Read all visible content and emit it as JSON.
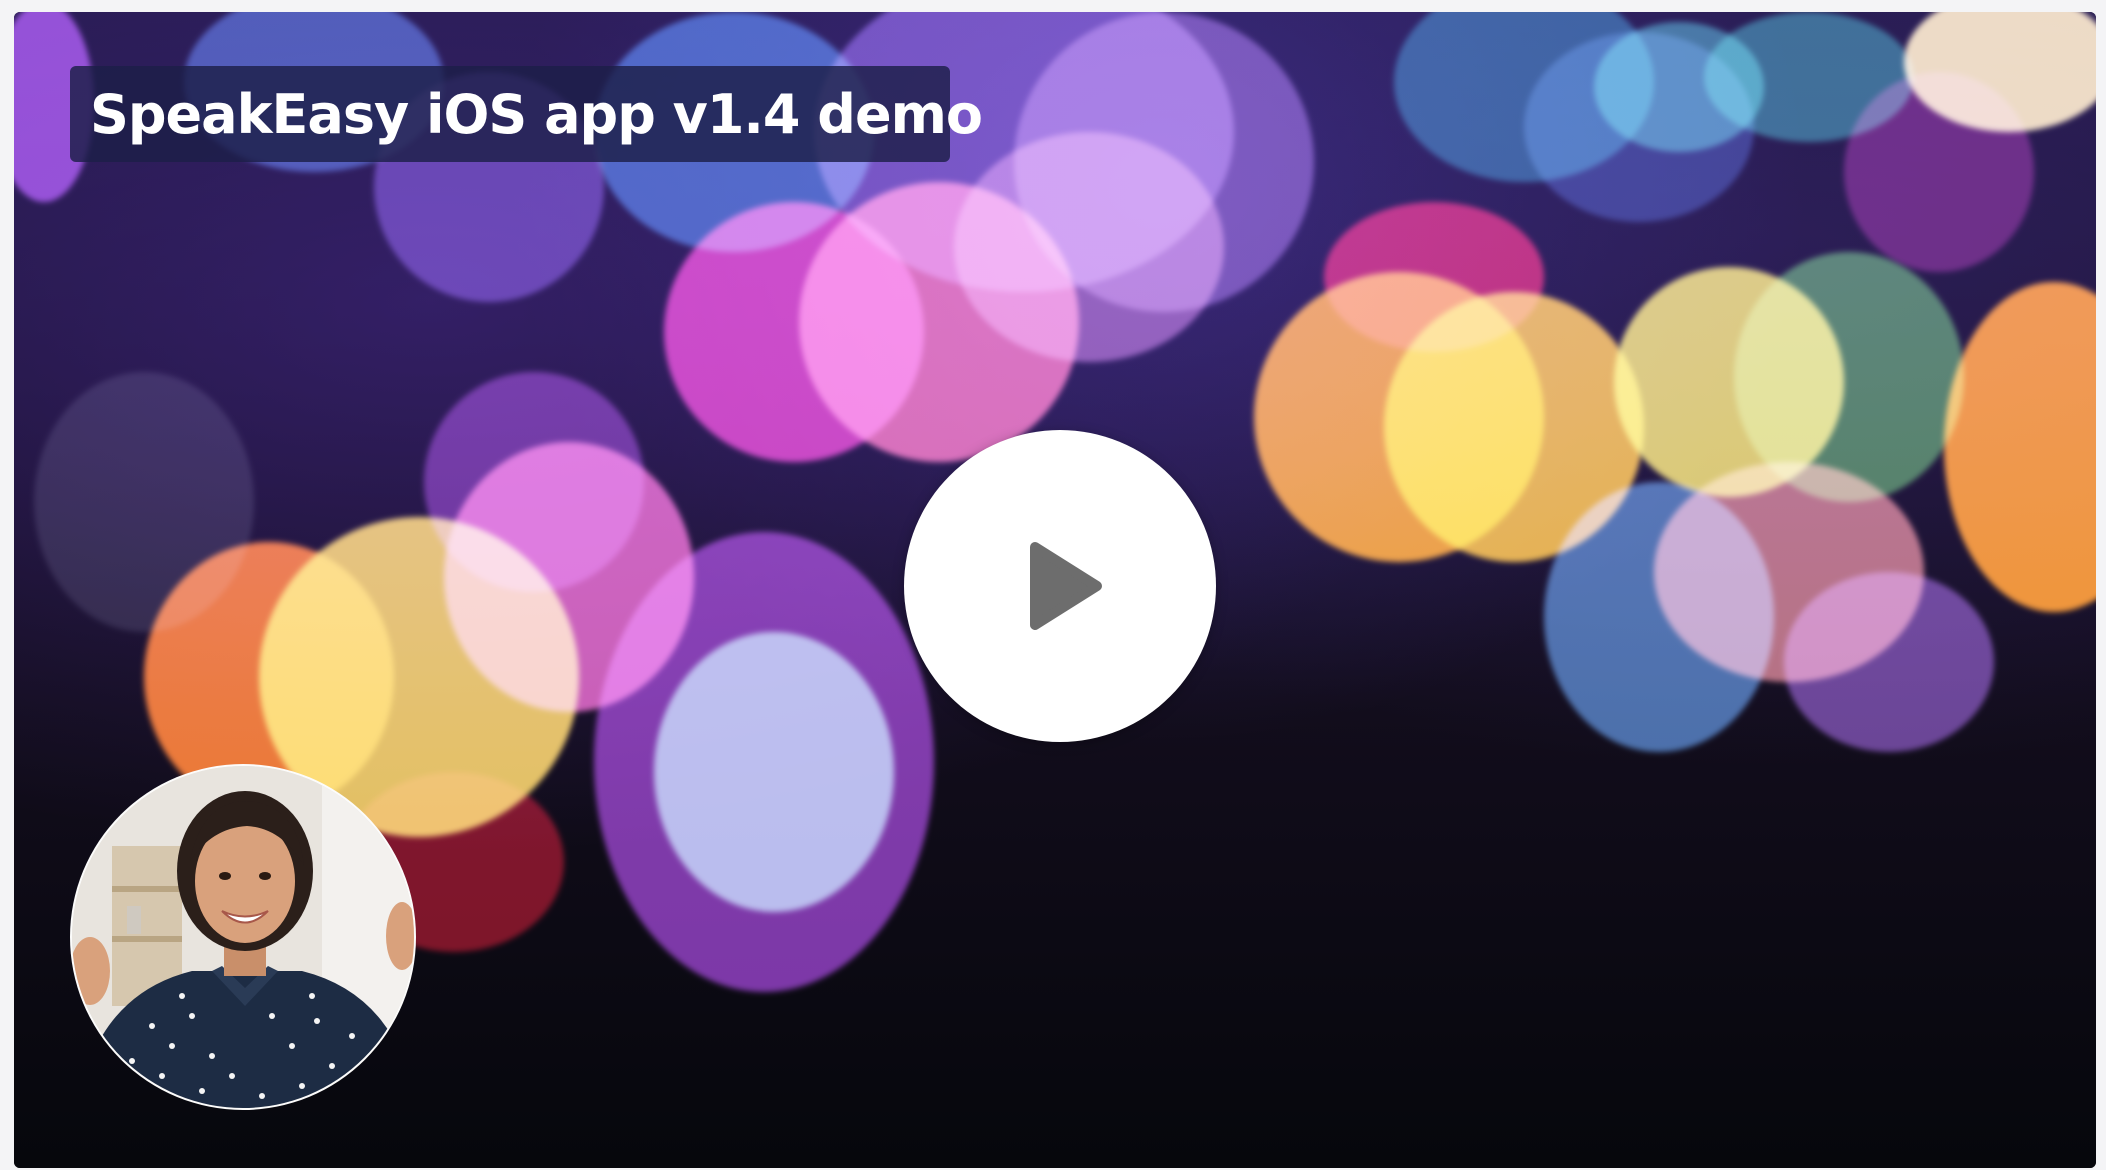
{
  "video": {
    "title": "SpeakEasy iOS app v1.4 demo"
  },
  "controls": {
    "play_icon": "play-triangle-icon"
  },
  "presenter": {
    "avatar_icon": "presenter-avatar"
  },
  "colors": {
    "title_bg": "#1c1e48",
    "play_bg": "#ffffff",
    "play_glyph": "#6d6d6d"
  }
}
